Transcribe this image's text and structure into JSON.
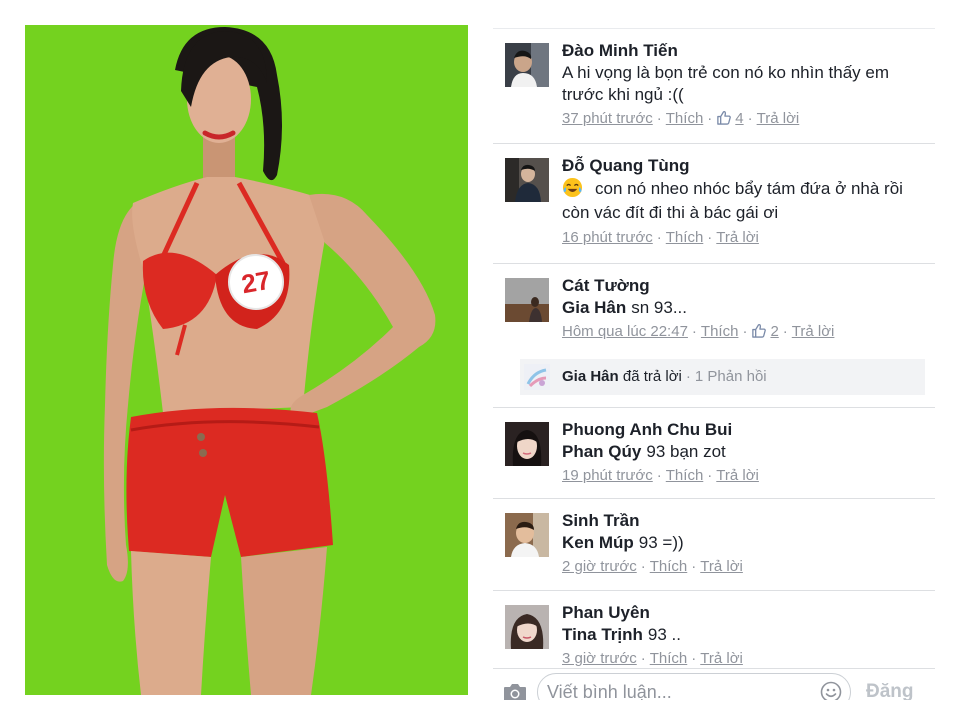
{
  "photo": {
    "badge_number": "27"
  },
  "colors": {
    "photo_background": "#74d21f",
    "text": "#1d2129",
    "meta_gray": "#90949c",
    "bikini_red": "#dc2a22"
  },
  "ui": {
    "separator": "·"
  },
  "comments": [
    {
      "author": "Đào Minh Tiến",
      "text": "A hi vọng là bọn trẻ con nó ko nhìn thấy em trước khi ngủ :((",
      "time": "37 phút trước",
      "like_label": "Thích",
      "like_count": "4",
      "reply_label": "Trả lời"
    },
    {
      "author": "Đỗ Quang Tùng",
      "emoji_icon": "tears-of-joy-icon",
      "text": "con nó nheo nhóc bẩy tám đứa ở nhà rồi còn vác đít đi thi à bác gái ơi",
      "time": "16 phút trước",
      "like_label": "Thích",
      "reply_label": "Trả lời"
    },
    {
      "author": "Cát Tường",
      "tag": "Gia Hân",
      "text": "sn 93...",
      "time": "Hôm qua lúc 22:47",
      "like_label": "Thích",
      "like_count": "2",
      "reply_label": "Trả lời",
      "reply_summary": {
        "author": "Gia Hân",
        "action": "đã trả lời",
        "count": "1 Phản hồi"
      }
    },
    {
      "author": "Phuong Anh Chu Bui",
      "tag": "Phan Qúy",
      "text": "93 bạn zot",
      "time": "19 phút trước",
      "like_label": "Thích",
      "reply_label": "Trả lời"
    },
    {
      "author": "Sinh Trần",
      "tag": "Ken Múp",
      "text": "93 =))",
      "time": "2 giờ trước",
      "like_label": "Thích",
      "reply_label": "Trả lời"
    },
    {
      "author": "Phan Uyên",
      "tag": "Tina Trịnh",
      "text": "93 ..",
      "time": "3 giờ trước",
      "like_label": "Thích",
      "reply_label": "Trả lời"
    }
  ],
  "composer": {
    "placeholder": "Viết bình luận...",
    "post_label": "Đăng"
  }
}
